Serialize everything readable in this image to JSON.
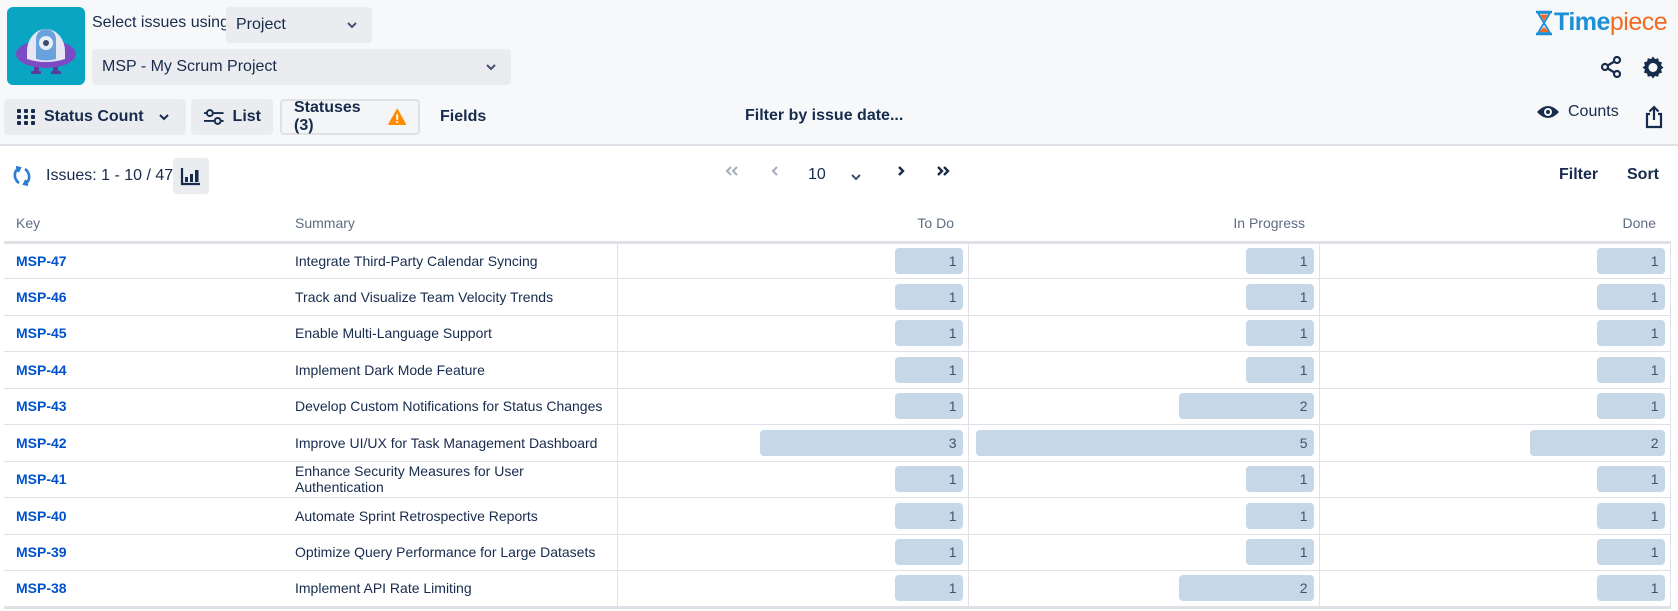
{
  "header": {
    "select_label": "Select issues using",
    "select_mode": "Project",
    "project": "MSP - My Scrum Project",
    "brand_part1": "Time",
    "brand_part2": "piece"
  },
  "toolbar": {
    "view": "Status Count",
    "list_label": "List",
    "statuses_label": "Statuses (3)",
    "fields_label": "Fields",
    "filter_date": "Filter by issue date...",
    "counts_label": "Counts",
    "warning_color": "#ff8b00"
  },
  "subbar": {
    "issues_count": "Issues: 1 - 10 / 47",
    "page_size": "10",
    "filter_label": "Filter",
    "sort_label": "Sort"
  },
  "table": {
    "columns": [
      "Key",
      "Summary",
      "To Do",
      "In Progress",
      "Done"
    ],
    "bar_color": "#c6d8e8",
    "link_color": "#0052cc",
    "rows": [
      {
        "key": "MSP-47",
        "summary": "Integrate Third-Party Calendar Syncing",
        "todo": 1,
        "inprogress": 1,
        "done": 1
      },
      {
        "key": "MSP-46",
        "summary": "Track and Visualize Team Velocity Trends",
        "todo": 1,
        "inprogress": 1,
        "done": 1
      },
      {
        "key": "MSP-45",
        "summary": "Enable Multi-Language Support",
        "todo": 1,
        "inprogress": 1,
        "done": 1
      },
      {
        "key": "MSP-44",
        "summary": "Implement Dark Mode Feature",
        "todo": 1,
        "inprogress": 1,
        "done": 1
      },
      {
        "key": "MSP-43",
        "summary": "Develop Custom Notifications for Status Changes",
        "todo": 1,
        "inprogress": 2,
        "done": 1
      },
      {
        "key": "MSP-42",
        "summary": "Improve UI/UX for Task Management Dashboard",
        "todo": 3,
        "inprogress": 5,
        "done": 2
      },
      {
        "key": "MSP-41",
        "summary": "Enhance Security Measures for User Authentication",
        "todo": 1,
        "inprogress": 1,
        "done": 1
      },
      {
        "key": "MSP-40",
        "summary": "Automate Sprint Retrospective Reports",
        "todo": 1,
        "inprogress": 1,
        "done": 1
      },
      {
        "key": "MSP-39",
        "summary": "Optimize Query Performance for Large Datasets",
        "todo": 1,
        "inprogress": 1,
        "done": 1
      },
      {
        "key": "MSP-38",
        "summary": "Implement API Rate Limiting",
        "todo": 1,
        "inprogress": 2,
        "done": 1
      }
    ],
    "max_value": 5
  }
}
